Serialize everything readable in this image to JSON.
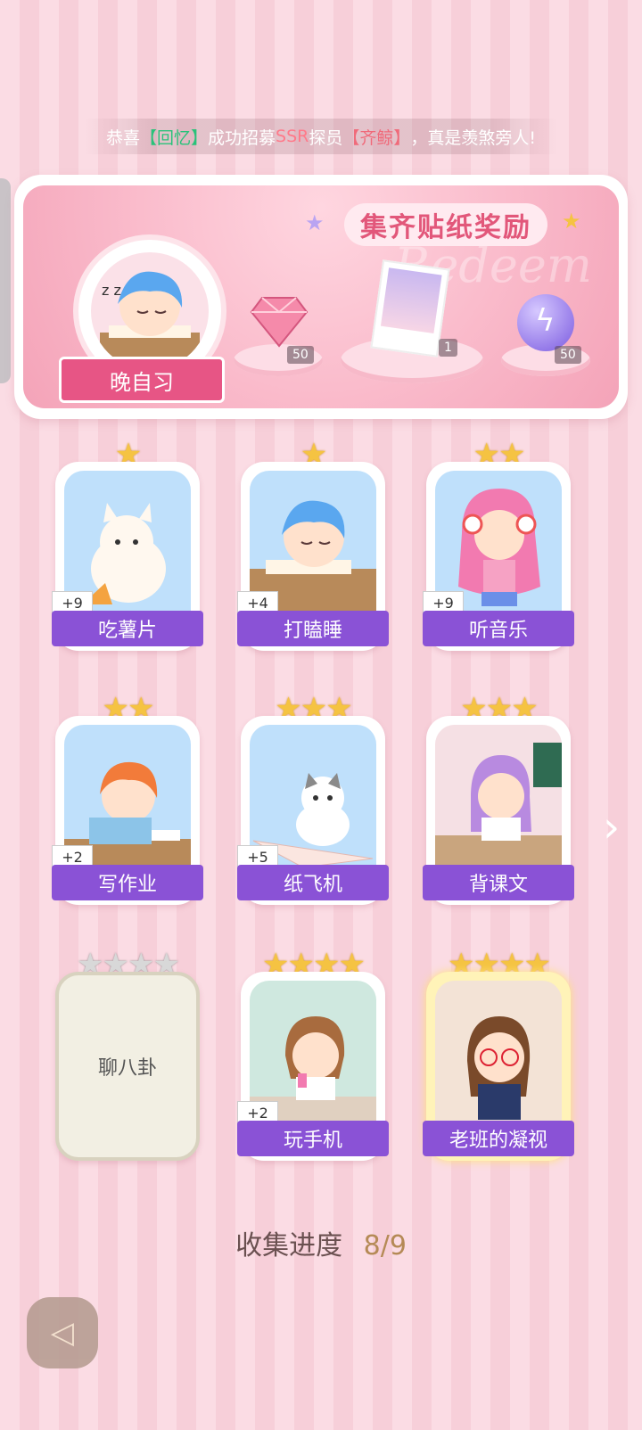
{
  "ticker": {
    "prefix": "恭喜",
    "name": "【回忆】",
    "middle": "成功招募",
    "rank": "SSR",
    "role": "探员",
    "target": "【齐鲸】",
    "suffix": "，真是羡煞旁人!"
  },
  "banner": {
    "title": "集齐贴纸奖励",
    "watermark": "Redeem",
    "avatar_label": "晚自习",
    "rewards": [
      {
        "name": "pink-gem",
        "count": "50"
      },
      {
        "name": "photo-card",
        "count": "1"
      },
      {
        "name": "energy-orb",
        "count": "50"
      }
    ]
  },
  "cards": [
    {
      "label": "吃薯片",
      "stars": "★",
      "plus": "+9",
      "star_count": 1
    },
    {
      "label": "打瞌睡",
      "stars": "★",
      "plus": "+4",
      "star_count": 1
    },
    {
      "label": "听音乐",
      "stars": "★★",
      "plus": "+9",
      "star_count": 2
    },
    {
      "label": "写作业",
      "stars": "★★",
      "plus": "+2",
      "star_count": 2
    },
    {
      "label": "纸飞机",
      "stars": "★★★",
      "plus": "+5",
      "star_count": 3
    },
    {
      "label": "背课文",
      "stars": "★★★",
      "plus": "",
      "star_count": 3
    },
    {
      "label": "聊八卦",
      "stars": "★★★★",
      "plus": "",
      "star_count": 4,
      "locked": true
    },
    {
      "label": "玩手机",
      "stars": "★★★★",
      "plus": "+2",
      "star_count": 4
    },
    {
      "label": "老班的凝视",
      "stars": "★★★★",
      "plus": "",
      "star_count": 4
    }
  ],
  "progress": {
    "label": "收集进度",
    "value": "8/9"
  },
  "icons": {
    "next": "chevron-right-icon",
    "back": "back-arrow-icon"
  }
}
